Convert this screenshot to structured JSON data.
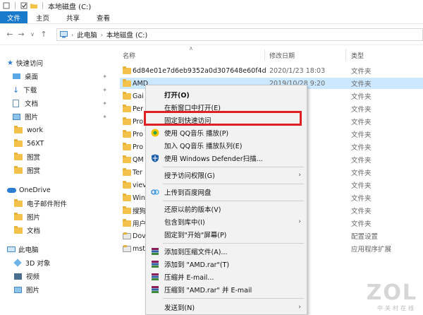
{
  "window": {
    "title": "本地磁盘 (C:)"
  },
  "ribbon": {
    "tabs": [
      "文件",
      "主页",
      "共享",
      "查看"
    ]
  },
  "address": {
    "crumbs": [
      "此电脑",
      "本地磁盘 (C:)"
    ]
  },
  "sidebar": {
    "items": [
      {
        "label": "快速访问",
        "icon": "star-icon"
      },
      {
        "label": "桌面",
        "icon": "desktop-icon"
      },
      {
        "label": "下载",
        "icon": "download-icon"
      },
      {
        "label": "文档",
        "icon": "document-icon"
      },
      {
        "label": "图片",
        "icon": "picture-icon"
      },
      {
        "label": "work",
        "icon": "folder-icon"
      },
      {
        "label": "56XT",
        "icon": "folder-icon"
      },
      {
        "label": "图赏",
        "icon": "folder-icon"
      },
      {
        "label": "图赏",
        "icon": "folder-icon"
      },
      {
        "label": "OneDrive",
        "icon": "cloud-icon"
      },
      {
        "label": "电子邮件附件",
        "icon": "folder-icon"
      },
      {
        "label": "图片",
        "icon": "folder-icon"
      },
      {
        "label": "文档",
        "icon": "folder-icon"
      },
      {
        "label": "此电脑",
        "icon": "computer-icon"
      },
      {
        "label": "3D 对象",
        "icon": "cube-icon"
      },
      {
        "label": "视频",
        "icon": "video-icon"
      },
      {
        "label": "图片",
        "icon": "picture-icon"
      }
    ]
  },
  "columns": {
    "name": "名称",
    "date": "修改日期",
    "type": "类型"
  },
  "files": [
    {
      "name": "6d84e01e7d6eb9352a0d307648e60f4d",
      "date": "2020/1/23 18:03",
      "type": "文件夹"
    },
    {
      "name": "AMD",
      "date": "2019/10/28 9:20",
      "type": "文件夹"
    },
    {
      "name": "Gai",
      "date": "11:31",
      "type": "文件夹"
    },
    {
      "name": "Per",
      "date": "12:52",
      "type": "文件夹"
    },
    {
      "name": "Pro",
      "date": "21:02",
      "type": "文件夹"
    },
    {
      "name": "Pro",
      "date": "21:02",
      "type": "文件夹"
    },
    {
      "name": "Pro",
      "date": "21:02",
      "type": "文件夹"
    },
    {
      "name": "QM",
      "date": "9:27",
      "type": "文件夹"
    },
    {
      "name": "Ter",
      "date": "15:14",
      "type": "文件夹"
    },
    {
      "name": "viev",
      "date": "16:00",
      "type": "文件夹"
    },
    {
      "name": "Win",
      "date": "19:25",
      "type": "文件夹"
    },
    {
      "name": "搜狗",
      "date": "17:53",
      "type": "文件夹"
    },
    {
      "name": "用户",
      "date": "21:02",
      "type": "文件夹"
    },
    {
      "name": "Dov",
      "date": "17:53",
      "type": "配置设置"
    },
    {
      "name": "mst",
      "date": "19:45",
      "type": "应用程序扩展"
    }
  ],
  "context_menu": {
    "items": [
      {
        "label": "打开(O)",
        "bold": true
      },
      {
        "label": "在新窗口中打开(E)"
      },
      {
        "label": "固定到快速访问"
      },
      {
        "label": "使用 QQ音乐 播放(P)",
        "icon": "qqmusic-icon"
      },
      {
        "label": "加入 QQ音乐 播放队列(E)"
      },
      {
        "label": "使用 Windows Defender扫描...",
        "icon": "defender-icon"
      },
      {
        "label": "授予访问权限(G)",
        "submenu": true
      },
      {
        "label": "上传到百度网盘",
        "icon": "baidu-cloud-icon"
      },
      {
        "label": "还原以前的版本(V)"
      },
      {
        "label": "包含到库中(I)",
        "submenu": true
      },
      {
        "label": "固定到\"开始\"屏幕(P)"
      },
      {
        "label": "添加到压缩文件(A)...",
        "icon": "winrar-icon"
      },
      {
        "label": "添加到 \"AMD.rar\"(T)",
        "icon": "winrar-icon"
      },
      {
        "label": "压缩并 E-mail...",
        "icon": "winrar-icon"
      },
      {
        "label": "压缩到 \"AMD.rar\" 并 E-mail",
        "icon": "winrar-icon"
      },
      {
        "label": "发送到(N)",
        "submenu": true
      }
    ]
  },
  "colors": {
    "accent": "#1979ca",
    "selection": "#cce8ff",
    "highlight_box": "#e02020"
  },
  "watermark": {
    "logo": "ZOL",
    "tagline": "中关村在线"
  }
}
